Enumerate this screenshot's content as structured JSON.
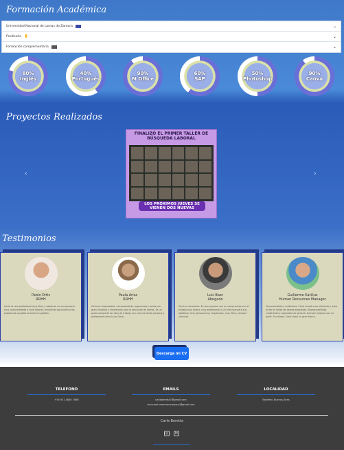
{
  "education": {
    "title": "Formación Académica",
    "items": [
      {
        "label": "Universidad Nacional de Lomas de Zamora"
      },
      {
        "label": "Prediseño"
      },
      {
        "label": "Formación complementaria"
      }
    ]
  },
  "skills": [
    {
      "pct": "80%",
      "name": "Inglés",
      "value": 80
    },
    {
      "pct": "40%",
      "name": "Portugués",
      "value": 40
    },
    {
      "pct": "90%",
      "name": "M Office",
      "value": 90
    },
    {
      "pct": "60%",
      "name": "SAP",
      "value": 60
    },
    {
      "pct": "50%",
      "name": "Photoshop",
      "value": 50
    },
    {
      "pct": "90%",
      "name": "Canva",
      "value": 90
    }
  ],
  "projects": {
    "title": "Proyectos Realizados",
    "slide_heading": "FINALIZÓ EL PRIMER TALLER DE BÚSQUEDA LABORAL",
    "slide_footer": "LOS PRÓXIMOS JUEVES SE VIENEN DOS NUEVAS"
  },
  "testimonials": {
    "title": "Testimonios",
    "cards": [
      {
        "name": "Pablo Ortiz",
        "role": "RRHH",
        "quote": "Carla es una profesional muy ética y sabemos es una persona muy comprometida a nivel laboral, brindando soluciones a los problemas surgidos durante en gestión."
      },
      {
        "name": "Paula Arias",
        "role": "RRHH",
        "quote": "Carla es responsable, comprometida, organizada, cuenta con gran iniciativa y dinamismo para la ejecución de tareas. Es un gusto compartir los días de trabajo con una excelente persona y profesional como lo es Carla."
      },
      {
        "name": "Luis Baer",
        "role": "Abogado",
        "quote": "Carla es excelente. Es una persona con un compromiso con el trabajo muy bueno, muy profesional y sin ello alcanzará sus objetivos. Una persona muy respetuosa, muy ética, siempre servicial."
      },
      {
        "name": "Guillermo Katilius",
        "role": "Human Resources Manager",
        "quote": "Comprometida y autónoma, Carla muestra ser eficiente y estar al día en todas las tareas asignadas. Responsabilidad, creatividad y capacidad de generar siempre mejoras son su perfil. Sin dudas, Carla tiene un gran futuro."
      }
    ]
  },
  "cv_button": "Descarga mi CV",
  "footer": {
    "phone_title": "TELEFONO",
    "phone": "+54 911 4840 7066",
    "emails_title": "EMAILS",
    "email1": "carlaberetta7@gmail.com",
    "email2": "recursoshumanoscompany@gmail.com",
    "location_title": "LOCALIDAD",
    "location": "Banfield, Buenos Aires",
    "owner": "Carla Beretta"
  }
}
